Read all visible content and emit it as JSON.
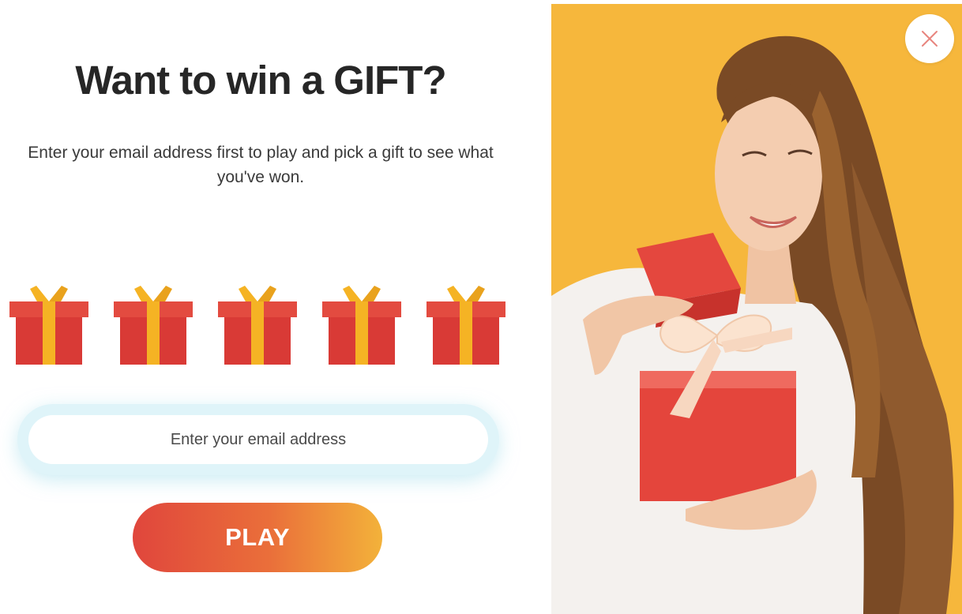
{
  "popup": {
    "title": "Want to win a GIFT?",
    "subtitle": "Enter your email address first to play and pick a gift to see what you've won.",
    "gifts": [
      {
        "icon": "gift-box-icon"
      },
      {
        "icon": "gift-box-icon"
      },
      {
        "icon": "gift-box-icon"
      },
      {
        "icon": "gift-box-icon"
      },
      {
        "icon": "gift-box-icon"
      }
    ],
    "email": {
      "placeholder": "Enter your email address",
      "value": ""
    },
    "play_label": "PLAY",
    "close_icon": "close-icon",
    "image": {
      "subject": "woman-opening-gift-photo"
    }
  },
  "colors": {
    "gift_red": "#d93a36",
    "gift_ribbon": "#f5b324",
    "play_gradient_start": "#e0463c",
    "play_gradient_end": "#f3b23a",
    "photo_background": "#f6b73c",
    "email_glow": "#dff4f9",
    "close_x": "#e8857e"
  }
}
